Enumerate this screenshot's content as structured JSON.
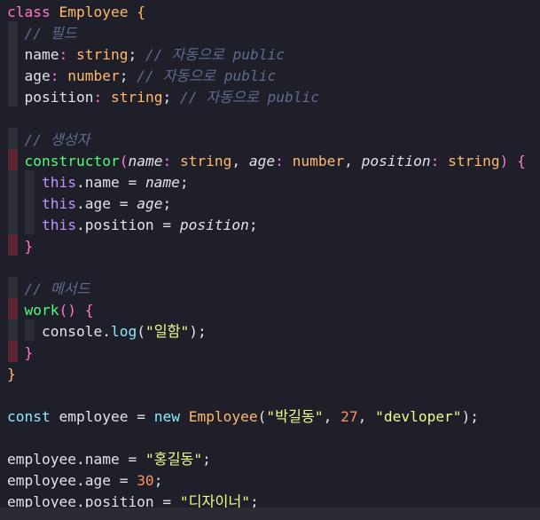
{
  "editor": {
    "lines": [
      {
        "class_kw": "class",
        "class_name": "Employee",
        "open_brace": "{"
      },
      {
        "comment": "// 필드"
      },
      {
        "prop": "name",
        "colon": ":",
        "type": "string",
        "semi": ";",
        "comment": "// 자동으로 public"
      },
      {
        "prop": "age",
        "colon": ":",
        "type": "number",
        "semi": ";",
        "comment": "// 자동으로 public"
      },
      {
        "prop": "position",
        "colon": ":",
        "type": "string",
        "semi": ";",
        "comment": "// 자동으로 public"
      },
      {
        "comment": "// 생성자"
      },
      {
        "ctor": "constructor",
        "open": "(",
        "p1": "name",
        "t1": "string",
        "p2": "age",
        "t2": "number",
        "p3": "position",
        "t3": "string",
        "close": ")",
        "brace": "{"
      },
      {
        "this_kw": "this",
        "rest": ".name = ",
        "param": "name",
        "semi": ";"
      },
      {
        "this_kw": "this",
        "rest": ".age = ",
        "param": "age",
        "semi": ";"
      },
      {
        "this_kw": "this",
        "rest": ".position = ",
        "param": "position",
        "semi": ";"
      },
      {
        "brace": "}"
      },
      {
        "comment": "// 메서드"
      },
      {
        "method": "work",
        "parens": "()",
        "brace": "{"
      },
      {
        "obj": "console",
        "dot": ".",
        "call": "log",
        "open": "(",
        "str": "\"일함\"",
        "close": ");"
      },
      {
        "brace": "}"
      },
      {
        "brace": "}"
      },
      {
        "const_kw": "const",
        "var": "employee",
        "eq": "=",
        "new_kw": "new",
        "cls": "Employee",
        "open": "(",
        "arg1": "\"박길동\"",
        "comma1": ",",
        "arg2": "27",
        "comma2": ",",
        "arg3": "\"devloper\"",
        "close": ");"
      },
      {
        "lhs": "employee.name = ",
        "str": "\"홍길동\"",
        "semi": ";"
      },
      {
        "lhs": "employee.age = ",
        "num": "30",
        "semi": ";"
      },
      {
        "lhs": "employee.position = ",
        "str": "\"디자이너\"",
        "semi": ";"
      }
    ]
  }
}
